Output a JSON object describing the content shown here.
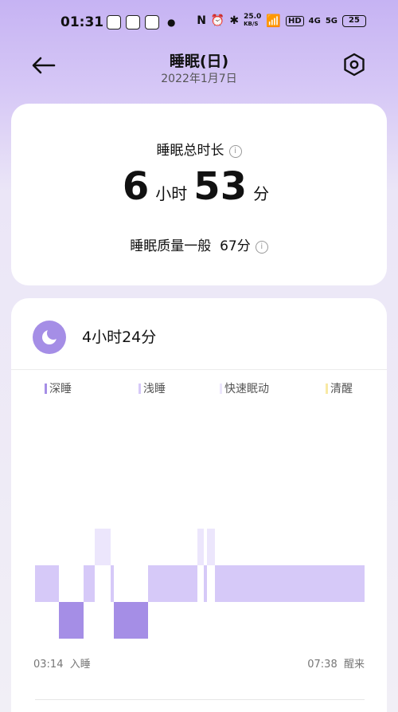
{
  "status_bar": {
    "time": "01:31",
    "net_speed": "25.0",
    "net_unit": "KB/S",
    "hd": "HD",
    "sig4g": "4G",
    "sig5g": "5G",
    "battery": "25"
  },
  "header": {
    "title": "睡眠(日)",
    "date": "2022年1月7日"
  },
  "summary": {
    "label": "睡眠总时长",
    "hours": "6",
    "hours_unit": "小时",
    "minutes": "53",
    "minutes_unit": "分",
    "quality_text": "睡眠质量一般",
    "quality_score": "67分"
  },
  "session": {
    "duration": "4小时24分",
    "legend": [
      {
        "label": "深睡",
        "color": "#a58ee6"
      },
      {
        "label": "浅睡",
        "color": "#d6c9f8"
      },
      {
        "label": "快速眠动",
        "color": "#ece6fc"
      },
      {
        "label": "清醒",
        "color": "#f8e9a4"
      }
    ],
    "start_time": "03:14",
    "start_label": "入睡",
    "end_time": "07:38",
    "end_label": "醒来"
  },
  "chart_data": {
    "type": "timeline",
    "x_start": "03:14",
    "x_end": "07:38",
    "stages": [
      "快速眠动",
      "浅睡",
      "深睡"
    ],
    "segments": [
      {
        "stage": "浅睡",
        "start": 0.0,
        "end": 0.072
      },
      {
        "stage": "深睡",
        "start": 0.072,
        "end": 0.147
      },
      {
        "stage": "浅睡",
        "start": 0.147,
        "end": 0.181
      },
      {
        "stage": "快速眠动",
        "start": 0.181,
        "end": 0.229
      },
      {
        "stage": "浅睡",
        "start": 0.229,
        "end": 0.24
      },
      {
        "stage": "深睡",
        "start": 0.24,
        "end": 0.343
      },
      {
        "stage": "浅睡",
        "start": 0.343,
        "end": 0.493
      },
      {
        "stage": "快速眠动",
        "start": 0.493,
        "end": 0.512
      },
      {
        "stage": "浅睡",
        "start": 0.512,
        "end": 0.522
      },
      {
        "stage": "快速眠动",
        "start": 0.522,
        "end": 0.546
      },
      {
        "stage": "浅睡",
        "start": 0.546,
        "end": 1.0
      }
    ]
  }
}
